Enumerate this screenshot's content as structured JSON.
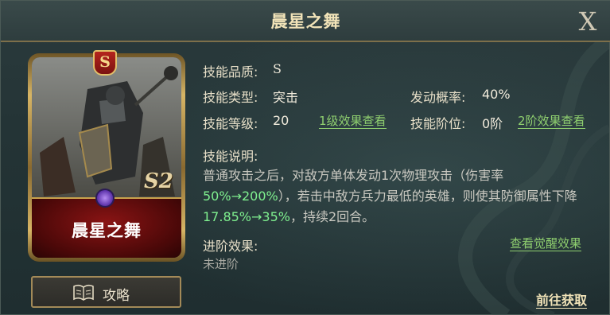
{
  "dialog": {
    "title": "晨星之舞",
    "close_label": "X"
  },
  "card": {
    "name": "晨星之舞",
    "grade_badge": "S",
    "season_mark": "S2"
  },
  "guide_button": {
    "label": "攻略",
    "icon": "book-icon"
  },
  "skill": {
    "quality_label": "技能品质:",
    "quality_value": "S",
    "type_label": "技能类型:",
    "type_value": "突击",
    "chance_label": "发动概率:",
    "chance_value": "40%",
    "level_label": "技能等级:",
    "level_value": "20",
    "level_link": "1级效果查看",
    "stage_label": "技能阶位:",
    "stage_value": "0阶",
    "stage_link": "2阶效果查看"
  },
  "description": {
    "label": "技能说明:",
    "part1": "普通攻击之后，对敌方单体发动1次物理攻击（伤害率",
    "hl1": "50%→200%",
    "part2": "），若击中敌方兵力最低的英雄，则使其防御属性下降",
    "hl2": "17.85%→35%",
    "part3": "，持续2回合。"
  },
  "advance": {
    "label": "进阶效果:",
    "link": "查看觉醒效果",
    "value": "未进阶"
  },
  "goto_label": "前往获取",
  "colors": {
    "highlight": "#7ff08f",
    "link": "#8fcf6f",
    "gold": "#d7b565"
  }
}
